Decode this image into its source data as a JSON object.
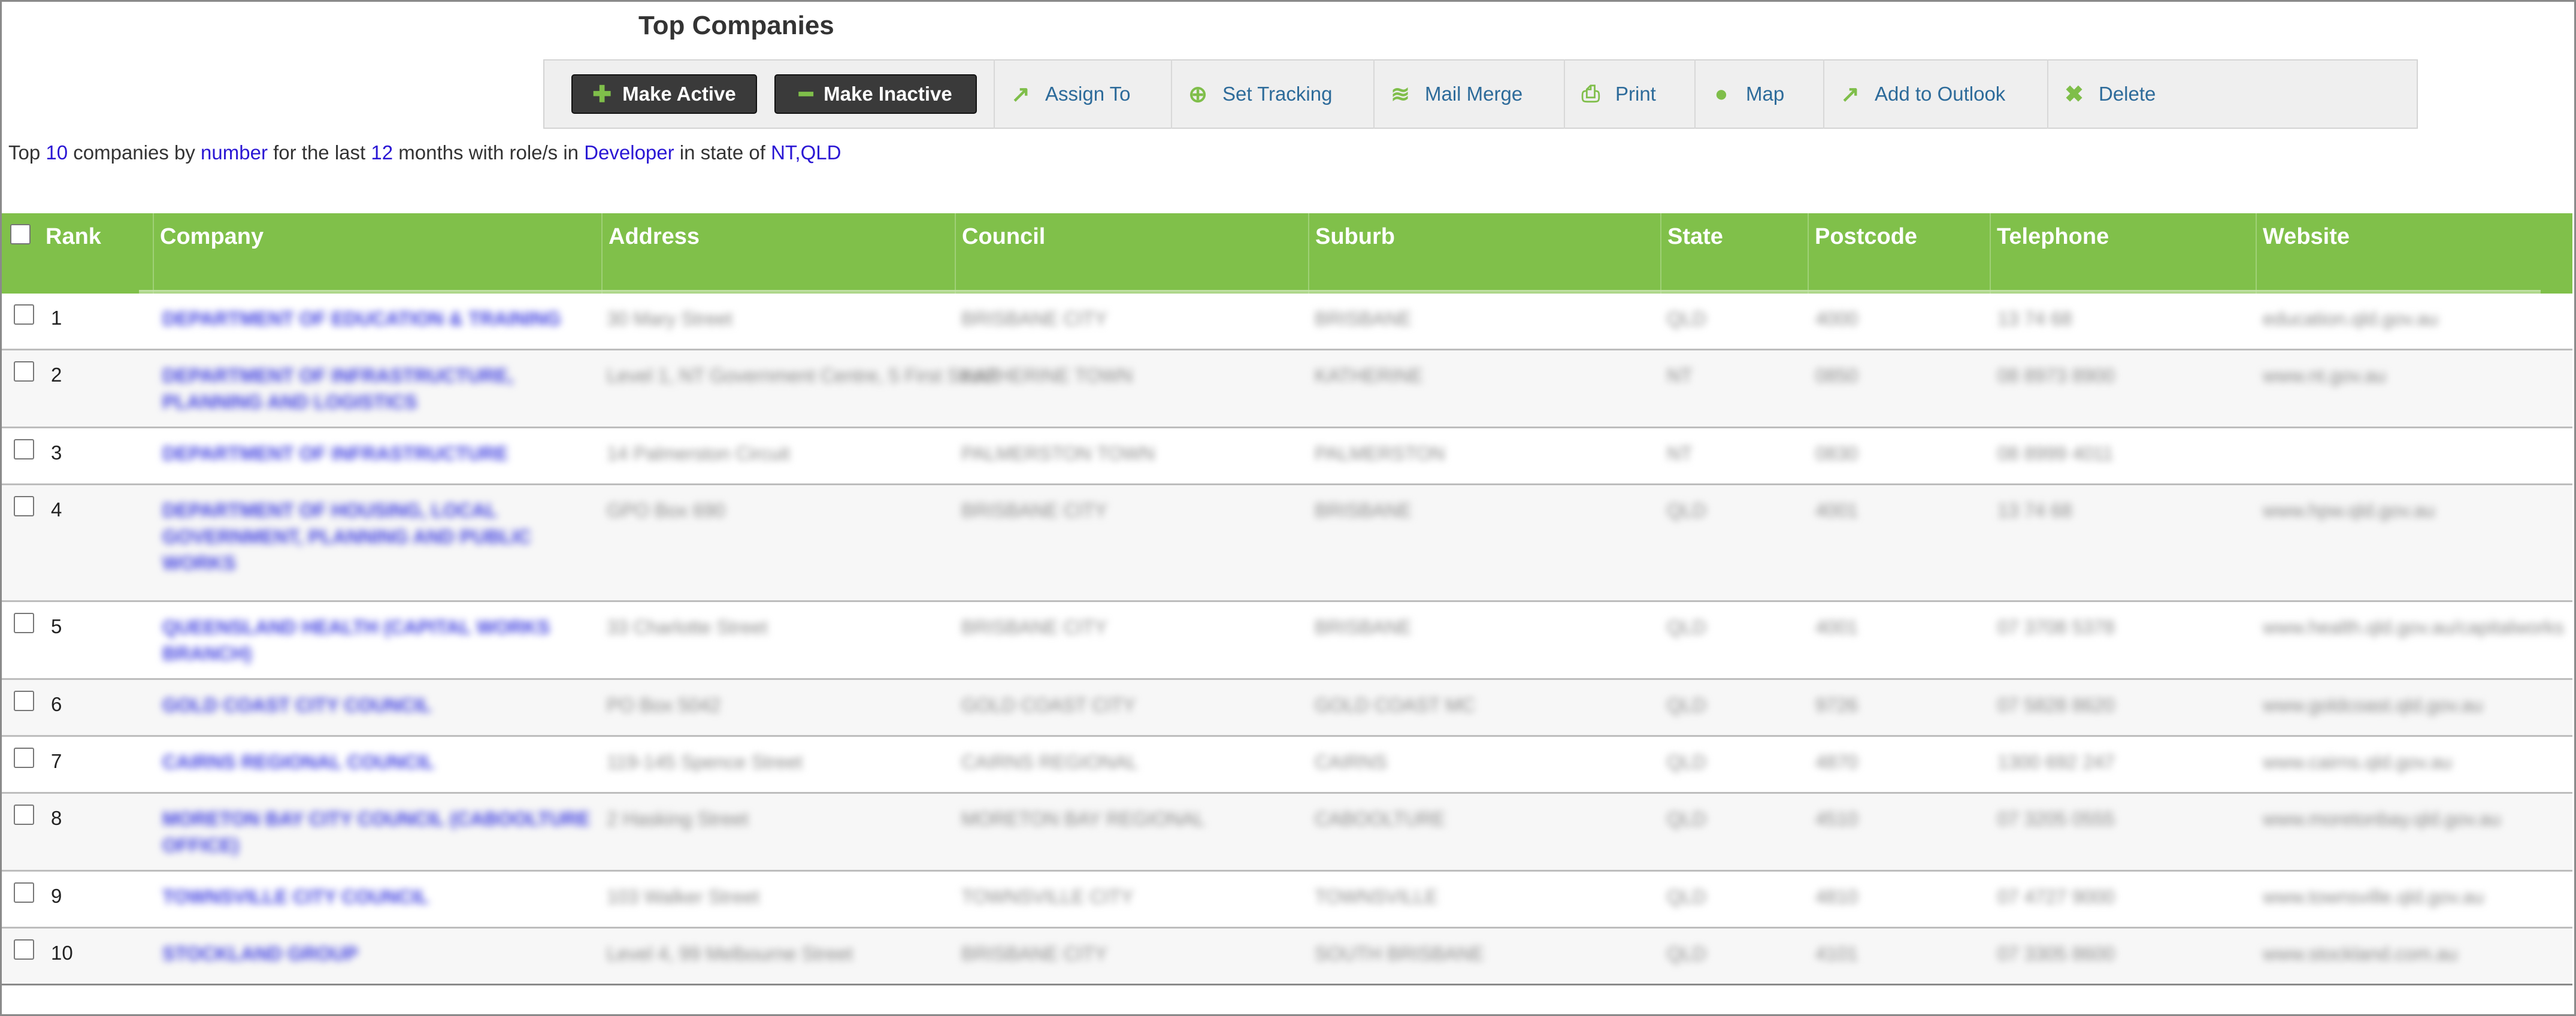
{
  "page_title": "Top Companies",
  "toolbar": {
    "make_active": "Make Active",
    "make_inactive": "Make Inactive",
    "assign_to": "Assign To",
    "set_tracking": "Set Tracking",
    "mail_merge": "Mail Merge",
    "print": "Print",
    "map": "Map",
    "add_to_outlook": "Add to Outlook",
    "delete": "Delete"
  },
  "summary": {
    "t1": "Top ",
    "count": "10",
    "t2": " companies by ",
    "metric": "number",
    "t3": " for the last ",
    "months": "12",
    "t4": " months with role/s in ",
    "role": "Developer",
    "t5": " in state of ",
    "states": "NT,QLD"
  },
  "table": {
    "columns": [
      "Rank",
      "Company",
      "Address",
      "Council",
      "Suburb",
      "State",
      "Postcode",
      "Telephone",
      "Website"
    ],
    "rows": [
      {
        "rank": "1",
        "company": "DEPARTMENT OF EDUCATION & TRAINING",
        "address": "30 Mary Street",
        "council": "BRISBANE CITY",
        "suburb": "BRISBANE",
        "state": "QLD",
        "postcode": "4000",
        "telephone": "13 74 68",
        "website": "education.qld.gov.au"
      },
      {
        "rank": "2",
        "company": "DEPARTMENT OF INFRASTRUCTURE, PLANNING AND LOGISTICS",
        "address": "Level 1, NT Government Centre, 5 First Street",
        "council": "KATHERINE TOWN",
        "suburb": "KATHERINE",
        "state": "NT",
        "postcode": "0850",
        "telephone": "08 8973 8900",
        "website": "www.nt.gov.au"
      },
      {
        "rank": "3",
        "company": "DEPARTMENT OF INFRASTRUCTURE",
        "address": "14 Palmerston Circuit",
        "council": "PALMERSTON TOWN",
        "suburb": "PALMERSTON",
        "state": "NT",
        "postcode": "0830",
        "telephone": "08 8999 4011",
        "website": ""
      },
      {
        "rank": "4",
        "company": "DEPARTMENT OF HOUSING, LOCAL GOVERNMENT, PLANNING AND PUBLIC WORKS",
        "address": "GPO Box 690",
        "council": "BRISBANE CITY",
        "suburb": "BRISBANE",
        "state": "QLD",
        "postcode": "4001",
        "telephone": "13 74 68",
        "website": "www.hpw.qld.gov.au"
      },
      {
        "rank": "5",
        "company": "QUEENSLAND HEALTH (CAPITAL WORKS BRANCH)",
        "address": "33 Charlotte Street",
        "council": "BRISBANE CITY",
        "suburb": "BRISBANE",
        "state": "QLD",
        "postcode": "4001",
        "telephone": "07 3708 5378",
        "website": "www.health.qld.gov.au/capitalworks"
      },
      {
        "rank": "6",
        "company": "GOLD COAST CITY COUNCIL",
        "address": "PO Box 5042",
        "council": "GOLD COAST CITY",
        "suburb": "GOLD COAST MC",
        "state": "QLD",
        "postcode": "9726",
        "telephone": "07 5828 8620",
        "website": "www.goldcoast.qld.gov.au"
      },
      {
        "rank": "7",
        "company": "CAIRNS REGIONAL COUNCIL",
        "address": "119-145 Spence Street",
        "council": "CAIRNS REGIONAL",
        "suburb": "CAIRNS",
        "state": "QLD",
        "postcode": "4870",
        "telephone": "1300 692 247",
        "website": "www.cairns.qld.gov.au"
      },
      {
        "rank": "8",
        "company": "MORETON BAY CITY COUNCIL (CABOOLTURE OFFICE)",
        "address": "2 Hasking Street",
        "council": "MORETON BAY REGIONAL",
        "suburb": "CABOOLTURE",
        "state": "QLD",
        "postcode": "4510",
        "telephone": "07 3205 0555",
        "website": "www.moretonbay.qld.gov.au"
      },
      {
        "rank": "9",
        "company": "TOWNSVILLE CITY COUNCIL",
        "address": "103 Walker Street",
        "council": "TOWNSVILLE CITY",
        "suburb": "TOWNSVILLE",
        "state": "QLD",
        "postcode": "4810",
        "telephone": "07 4727 9000",
        "website": "www.townsville.qld.gov.au"
      },
      {
        "rank": "10",
        "company": "STOCKLAND GROUP",
        "address": "Level 4, 99 Melbourne Street",
        "council": "BRISBANE CITY",
        "suburb": "SOUTH BRISBANE",
        "state": "QLD",
        "postcode": "4101",
        "telephone": "07 3305 8600",
        "website": "www.stockland.com.au"
      }
    ]
  },
  "colors": {
    "header_green": "#80c04a",
    "link_blue": "#2a16d4",
    "toolbar_link": "#2d6b9a",
    "icon_green": "#7fbe4a"
  },
  "icons": [
    "plus-icon",
    "minus-icon",
    "arrow-up-right-icon",
    "crosshair-icon",
    "layers-icon",
    "printer-icon",
    "map-pin-icon",
    "close-icon"
  ]
}
